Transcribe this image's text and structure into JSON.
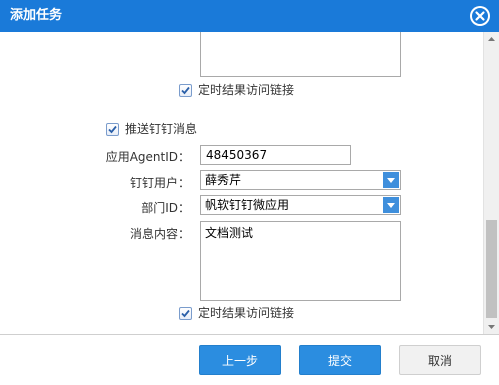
{
  "dialog": {
    "title": "添加任务",
    "close_icon": "close-circle-icon",
    "accent_color": "#1a7ad9"
  },
  "upper_section": {
    "timed_result_link": {
      "label": "定时结果访问链接",
      "checked": true
    }
  },
  "dingtalk": {
    "push_checkbox": {
      "label": "推送钉钉消息",
      "checked": true
    },
    "agent_id": {
      "label": "应用AgentID：",
      "value": "48450367"
    },
    "user": {
      "label": "钉钉用户：",
      "selected": "薛秀芹"
    },
    "department": {
      "label": "部门ID：",
      "selected": "帆软钉钉微应用"
    },
    "message": {
      "label": "消息内容：",
      "value": "文档测试"
    },
    "timed_result_link": {
      "label": "定时结果访问链接",
      "checked": true
    }
  },
  "footer": {
    "prev_label": "上一步",
    "submit_label": "提交",
    "cancel_label": "取消"
  },
  "scrollbar": {
    "position": 0.85
  }
}
